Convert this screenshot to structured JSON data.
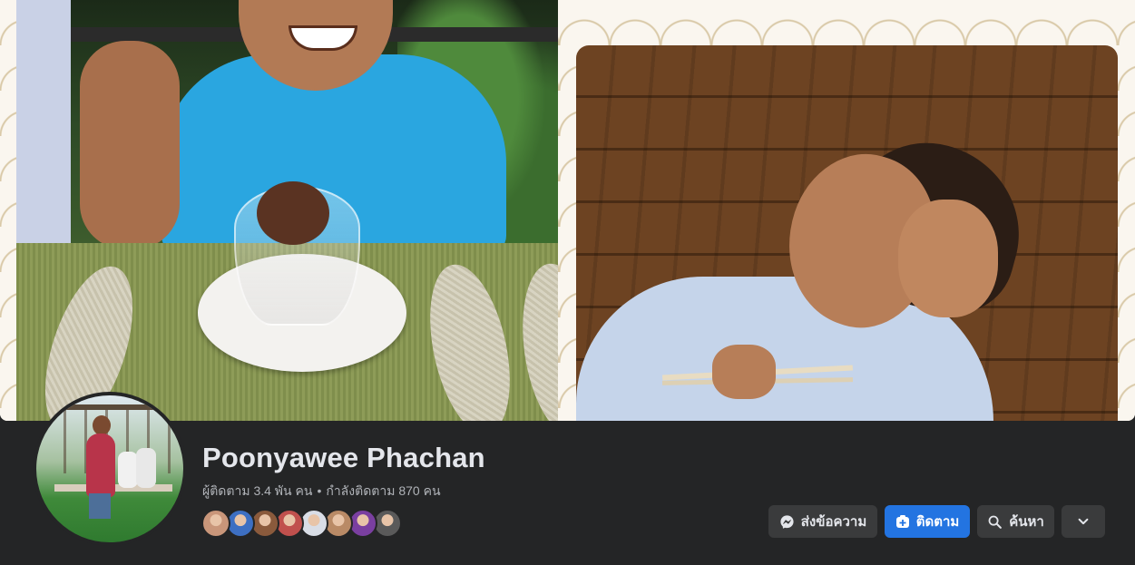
{
  "profile": {
    "name": "Poonyawee Phachan",
    "followers_text": "ผู้ติดตาม 3.4 พัน คน",
    "separator": "•",
    "following_text": "กำลังติดตาม 870 คน"
  },
  "friend_avatars": [
    {
      "color": "#c9967a"
    },
    {
      "color": "#3d6fc2"
    },
    {
      "color": "#8a5a3c"
    },
    {
      "color": "#c0504d"
    },
    {
      "color": "#d9dde6"
    },
    {
      "color": "#b98a66"
    },
    {
      "color": "#7a3fa0"
    },
    {
      "color": "#5a5a5a"
    }
  ],
  "actions": {
    "message_label": "ส่งข้อความ",
    "follow_label": "ติดตาม",
    "search_label": "ค้นหา"
  },
  "icons": {
    "message": "messenger-icon",
    "follow": "follow-plus-icon",
    "search": "search-icon",
    "more": "chevron-down-icon"
  },
  "colors": {
    "background": "#242526",
    "primary_button": "#2374e1",
    "secondary_button": "#3a3b3c",
    "text_primary": "#e4e6eb",
    "text_secondary": "#b0b3b8"
  }
}
